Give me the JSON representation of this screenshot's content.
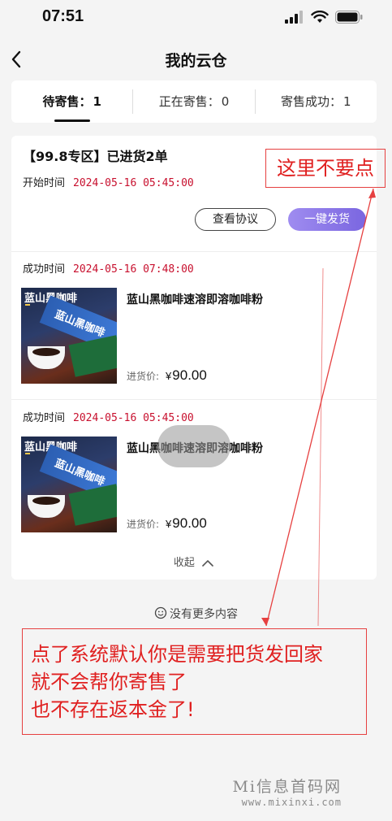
{
  "status": {
    "time": "07:51"
  },
  "nav": {
    "title": "我的云仓"
  },
  "tabs": [
    {
      "label": "待寄售：",
      "count": "1"
    },
    {
      "label": "正在寄售：",
      "count": "0"
    },
    {
      "label": "寄售成功：",
      "count": "1"
    }
  ],
  "order": {
    "title": "【99.8专区】已进货2单",
    "start_label": "开始时间",
    "start_time": "2024-05-16 05:45:00",
    "agreement_button": "查看协议",
    "ship_button": "一键发货"
  },
  "items": [
    {
      "success_label": "成功时间",
      "success_time": "2024-05-16 07:48:00",
      "image_brand": "蓝山黑咖啡",
      "image_box_text": "蓝山黑咖啡",
      "name": "蓝山黑咖啡速溶即溶咖啡粉",
      "price_label": "进货价:",
      "currency": "¥",
      "price": "90.00"
    },
    {
      "success_label": "成功时间",
      "success_time": "2024-05-16 05:45:00",
      "image_brand": "蓝山黑咖啡",
      "image_box_text": "蓝山黑咖啡",
      "name": "蓝山黑咖啡速溶即溶咖啡粉",
      "price_label": "进货价:",
      "currency": "¥",
      "price": "90.00"
    }
  ],
  "collapse_label": "收起",
  "no_more": "没有更多内容",
  "annotations": {
    "top": "这里不要点",
    "bottom_lines": [
      "点了系统默认你是需要把货发回家",
      "就不会帮你寄售了",
      "也不存在返本金了!"
    ]
  },
  "watermark": {
    "line1": "Mi信息首码网",
    "line2": "www.mixinxi.com"
  },
  "colors": {
    "accent_red": "#c8102e",
    "ship_button": "#8c79ea",
    "annotation_red": "#e02020"
  }
}
